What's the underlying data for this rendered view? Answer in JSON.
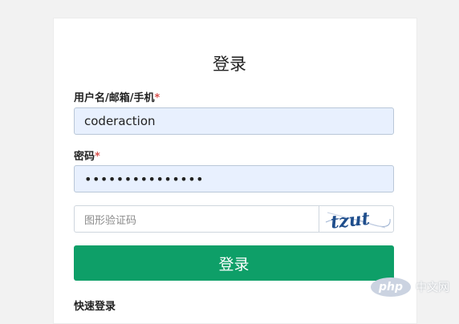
{
  "form": {
    "title": "登录",
    "username_label": "用户名/邮箱/手机",
    "username_required": "*",
    "username_value": "coderaction",
    "password_label": "密码",
    "password_required": "*",
    "password_dots": "•••••••••••••••",
    "captcha_placeholder": "图形验证码",
    "captcha_text": "tzut",
    "submit_label": "登录",
    "quick_login_label": "快速登录"
  },
  "watermark": {
    "logo_text": "php",
    "site_text": "中文网"
  },
  "colors": {
    "accent": "#0e9f68",
    "required": "#d9534f",
    "autofill_bg": "#e8f0fe"
  }
}
